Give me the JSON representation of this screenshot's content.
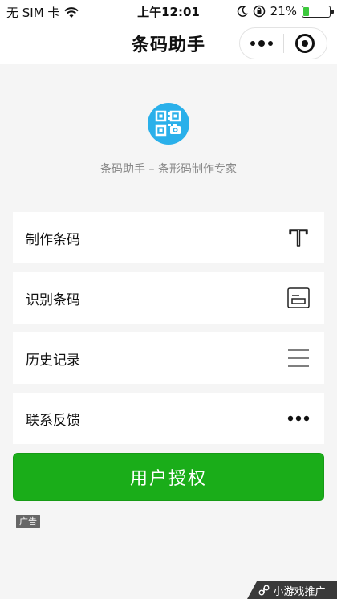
{
  "status_bar": {
    "carrier": "无 SIM 卡",
    "time": "上午12:01",
    "battery_percent": "21%",
    "battery_level": 0.21
  },
  "nav": {
    "title": "条码助手"
  },
  "app": {
    "subtitle": "条码助手 – 条形码制作专家"
  },
  "menu": [
    {
      "label": "制作条码",
      "icon": "text-t-icon"
    },
    {
      "label": "识别条码",
      "icon": "scan-frame-icon"
    },
    {
      "label": "历史记录",
      "icon": "list-lines-icon"
    },
    {
      "label": "联系反馈",
      "icon": "more-dots-icon"
    }
  ],
  "auth_button": {
    "label": "用户授权"
  },
  "ad_label": "广告",
  "mini_game": {
    "label": "小游戏推广"
  },
  "colors": {
    "primary_green": "#1aad19",
    "logo_blue": "#2ab0ea",
    "battery_green": "#3cc83c"
  }
}
